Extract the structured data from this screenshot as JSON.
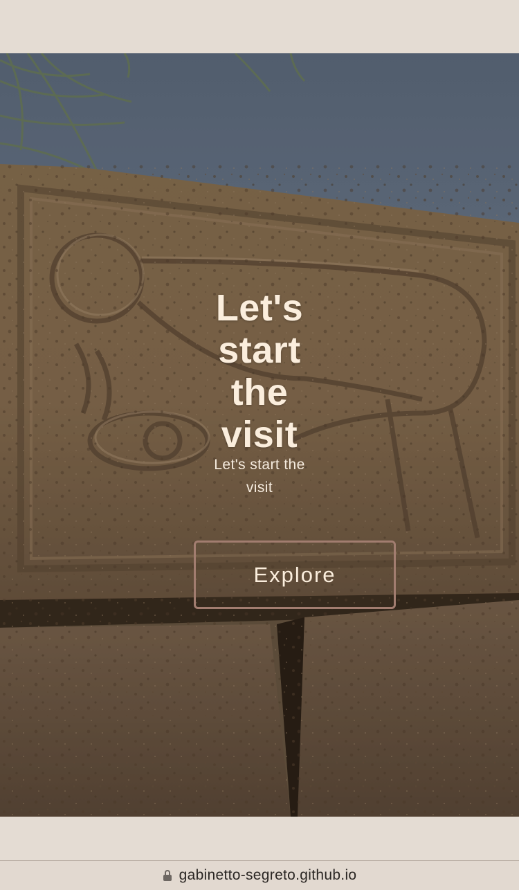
{
  "hero": {
    "title": "Let's start the visit",
    "subtitle": "Let's start the visit",
    "button_label": "Explore",
    "image_icon": "carved-stone-relief-image"
  },
  "browser": {
    "url": "gabinetto-segreto.github.io",
    "lock_icon": "lock-icon"
  },
  "colors": {
    "page_background": "#e4dcd3",
    "title_text": "#fbeedd",
    "button_border": "#a27d70"
  }
}
